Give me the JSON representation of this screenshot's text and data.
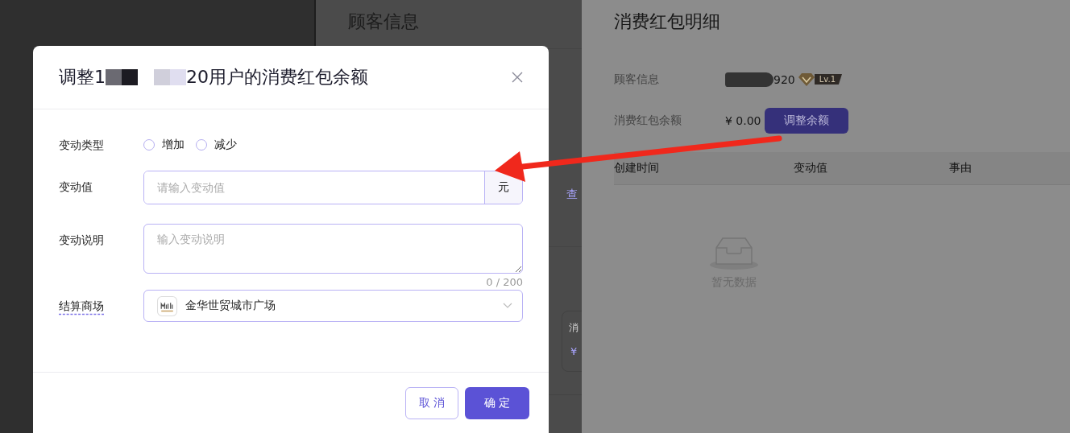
{
  "background_panel": {
    "title": "顾客信息",
    "link": "查",
    "card": {
      "label": "消",
      "value": "¥"
    }
  },
  "detail_panel": {
    "title": "消费红包明细",
    "customer_label": "顾客信息",
    "customer_value": "920",
    "level_badge": "Lv.1",
    "balance_label": "消费红包余额",
    "balance_value": "¥ 0.00",
    "adjust_button": "调整余额",
    "table": {
      "columns": [
        "创建时间",
        "变动值",
        "事由"
      ],
      "empty_text": "暂无数据"
    }
  },
  "dialog": {
    "title_start": "调整1",
    "title_end": "20用户的消费红包余额",
    "fields": [
      {
        "kind": "radio",
        "label": "变动类型",
        "options": [
          {
            "label": "增加",
            "selected": false
          },
          {
            "label": "减少",
            "selected": false
          }
        ]
      },
      {
        "kind": "input",
        "label": "变动值",
        "placeholder": "请输入变动值",
        "suffix": "元"
      },
      {
        "kind": "textarea",
        "label": "变动说明",
        "placeholder": "输入变动说明",
        "counter": "0 / 200"
      },
      {
        "kind": "select",
        "label": "结算商场",
        "value": "金华世贸城市广场"
      }
    ],
    "buttons": [
      {
        "label": "取 消",
        "kind": "secondary"
      },
      {
        "label": "确 定",
        "kind": "primary"
      }
    ]
  }
}
